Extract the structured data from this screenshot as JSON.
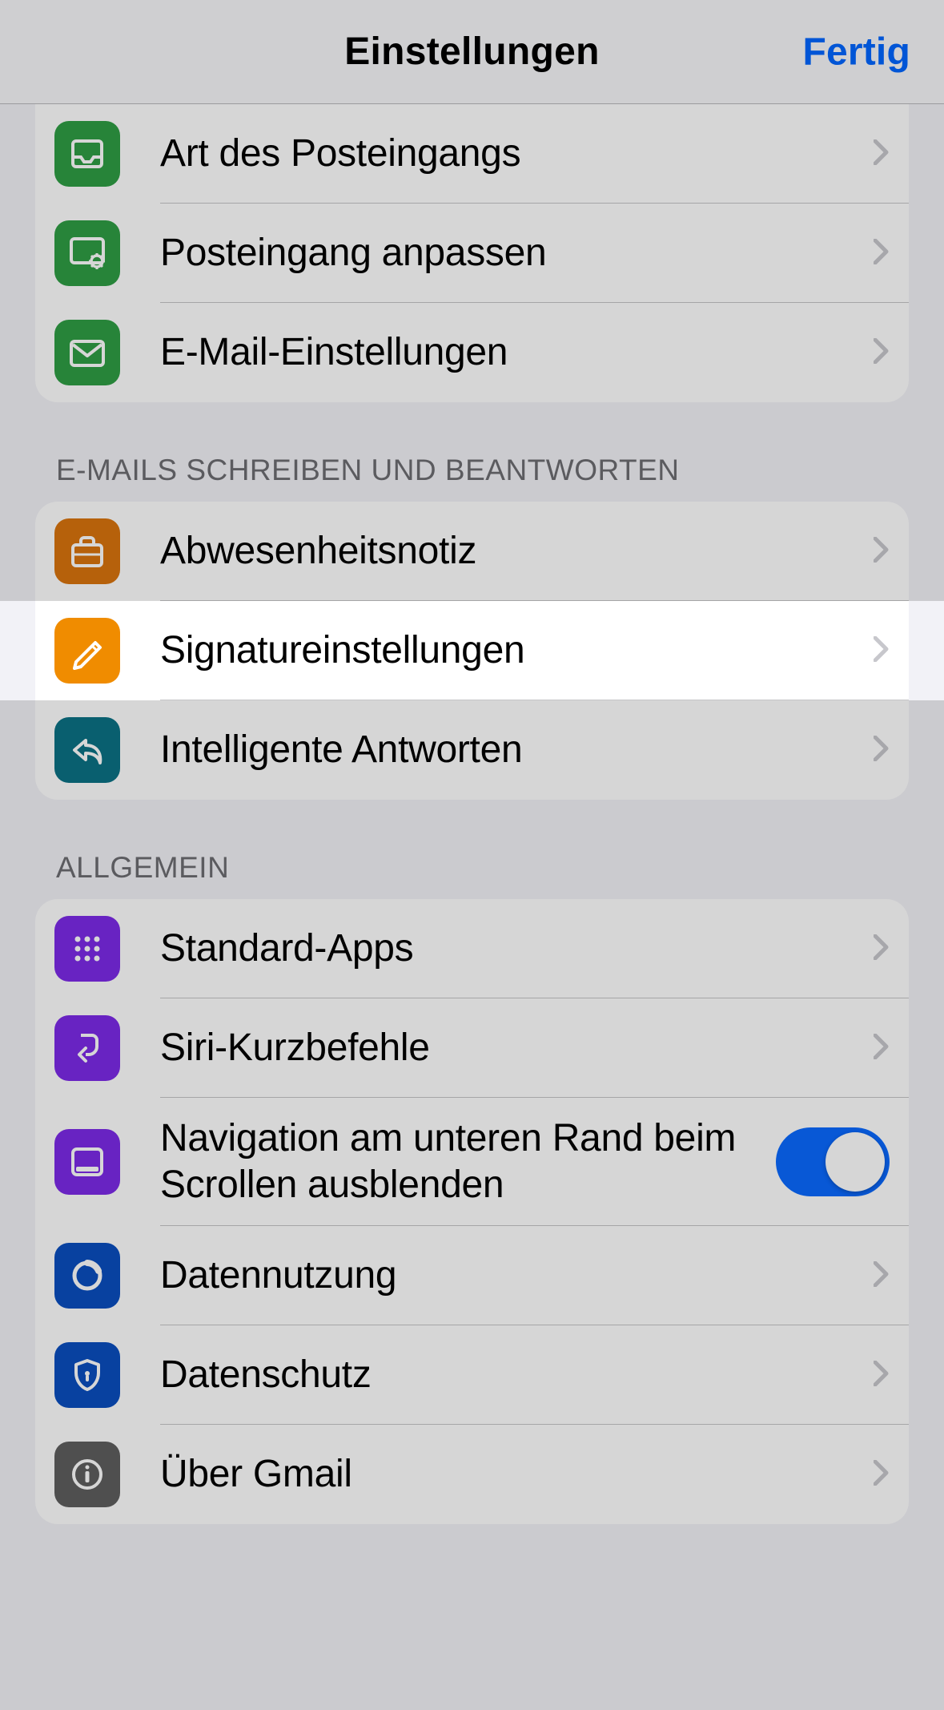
{
  "navbar": {
    "title": "Einstellungen",
    "done": "Fertig"
  },
  "sections": {
    "inbox": {
      "items": [
        {
          "label": "Art des Posteingangs",
          "icon": "inbox-tray-icon",
          "color": "green"
        },
        {
          "label": "Posteingang anpassen",
          "icon": "customize-icon",
          "color": "green"
        },
        {
          "label": "E-Mail-Einstellungen",
          "icon": "mail-icon",
          "color": "green"
        }
      ]
    },
    "compose": {
      "header": "E-MAILS SCHREIBEN UND BEANTWORTEN",
      "items": [
        {
          "label": "Abwesenheitsnotiz",
          "icon": "briefcase-icon",
          "color": "orange1"
        },
        {
          "label": "Signatureinstellungen",
          "icon": "pencil-icon",
          "color": "orange2"
        },
        {
          "label": "Intelligente Antworten",
          "icon": "reply-icon",
          "color": "teal"
        }
      ]
    },
    "general": {
      "header": "ALLGEMEIN",
      "items": [
        {
          "label": "Standard-Apps",
          "icon": "grid-icon",
          "color": "purple"
        },
        {
          "label": "Siri-Kurzbefehle",
          "icon": "shortcut-icon",
          "color": "purple"
        },
        {
          "label": "Navigation am unteren Rand beim Scrollen ausblenden",
          "icon": "navbar-icon",
          "color": "purple",
          "toggle": true,
          "value": true
        },
        {
          "label": "Datennutzung",
          "icon": "data-usage-icon",
          "color": "blue"
        },
        {
          "label": "Datenschutz",
          "icon": "shield-icon",
          "color": "blue"
        },
        {
          "label": "Über Gmail",
          "icon": "info-icon",
          "color": "gray"
        }
      ]
    }
  }
}
